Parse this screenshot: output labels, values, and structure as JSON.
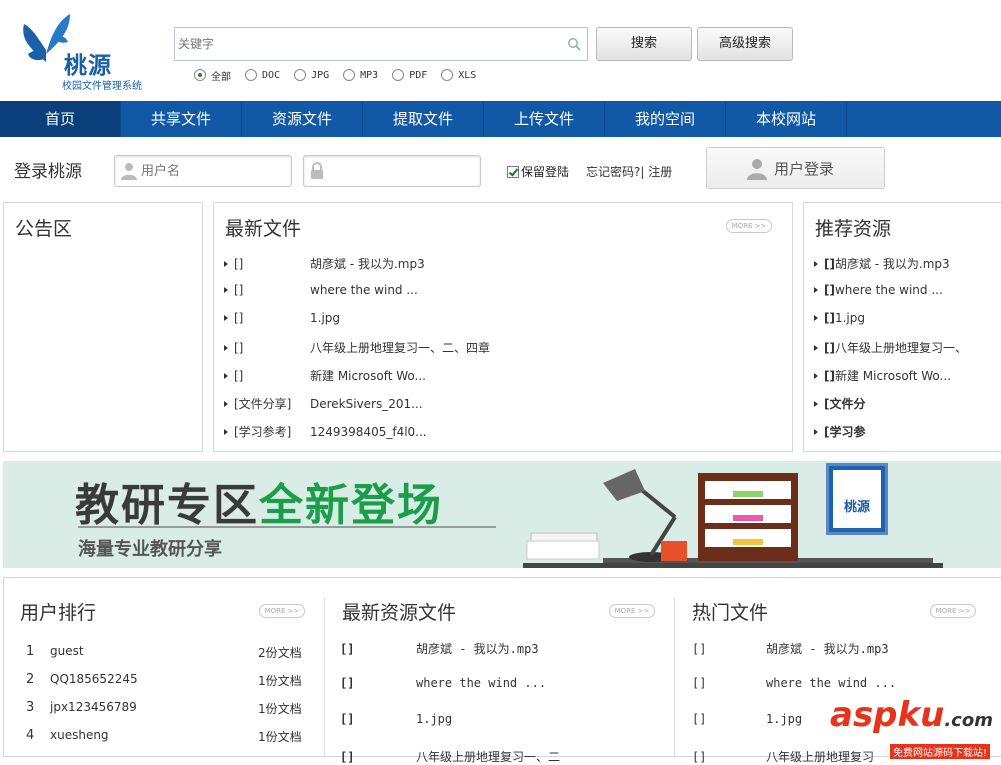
{
  "logo": {
    "name": "桃源",
    "subtitle": "校园文件管理系统"
  },
  "search": {
    "placeholder": "关键字",
    "search_label": "搜索",
    "advanced_label": "高级搜索"
  },
  "file_types": [
    {
      "label": "全部",
      "selected": true
    },
    {
      "label": "DOC",
      "selected": false
    },
    {
      "label": "JPG",
      "selected": false
    },
    {
      "label": "MP3",
      "selected": false
    },
    {
      "label": "PDF",
      "selected": false
    },
    {
      "label": "XLS",
      "selected": false
    }
  ],
  "nav": [
    "首页",
    "共享文件",
    "资源文件",
    "提取文件",
    "上传文件",
    "我的空间",
    "本校网站"
  ],
  "login": {
    "label": "登录桃源",
    "username_placeholder": "用户名",
    "remember_label": "保留登陆",
    "forgot_label": "忘记密码?| 注册",
    "button_label": "用户登录"
  },
  "notice": {
    "title": "公告区"
  },
  "latest_files": {
    "title": "最新文件",
    "more": "MORE >>",
    "items": [
      {
        "cat": "[]",
        "name": "胡彦斌 - 我以为.mp3"
      },
      {
        "cat": "[]",
        "name": "where the wind ..."
      },
      {
        "cat": "[]",
        "name": "1.jpg"
      },
      {
        "cat": "[]",
        "name": "八年级上册地理复习一、二、四章"
      },
      {
        "cat": "[]",
        "name": "新建 Microsoft Wo..."
      },
      {
        "cat": "[文件分享]",
        "name": "DerekSivers_201..."
      },
      {
        "cat": "[学习参考]",
        "name": "1249398405_f4l0..."
      }
    ]
  },
  "recommended": {
    "title": "推荐资源",
    "items": [
      {
        "cat": "[]",
        "name": "胡彦斌 - 我以为.mp3"
      },
      {
        "cat": "[]",
        "name": "where the wind ..."
      },
      {
        "cat": "[]",
        "name": "1.jpg"
      },
      {
        "cat": "[]",
        "name": "八年级上册地理复习一、"
      },
      {
        "cat": "[]",
        "name": "新建 Microsoft Wo..."
      },
      {
        "cat": "[文件分",
        "name": ""
      },
      {
        "cat": "[学习参",
        "name": ""
      }
    ]
  },
  "banner": {
    "title_dark": "教研专区",
    "title_green": "全新登场",
    "subtitle": "海量专业教研分享",
    "badge": "桃源"
  },
  "user_rank": {
    "title": "用户排行",
    "more": "MORE >>",
    "items": [
      {
        "rank": "1",
        "name": "guest",
        "count": "2份文档"
      },
      {
        "rank": "2",
        "name": "QQ185652245",
        "count": "1份文档"
      },
      {
        "rank": "3",
        "name": "jpx123456789",
        "count": "1份文档"
      },
      {
        "rank": "4",
        "name": "xuesheng",
        "count": "1份文档"
      }
    ]
  },
  "latest_resources": {
    "title": "最新资源文件",
    "more": "MORE >>",
    "items": [
      {
        "cat": "[]",
        "name": "胡彦斌 - 我以为.mp3"
      },
      {
        "cat": "[]",
        "name": "where the wind ..."
      },
      {
        "cat": "[]",
        "name": "1.jpg"
      },
      {
        "cat": "[]",
        "name": "八年级上册地理复习一、二"
      }
    ]
  },
  "hot_files": {
    "title": "热门文件",
    "more": "MORE >>",
    "items": [
      {
        "cat": "[]",
        "name": "胡彦斌 - 我以为.mp3"
      },
      {
        "cat": "[]",
        "name": "where the wind ..."
      },
      {
        "cat": "[]",
        "name": "1.jpg"
      },
      {
        "cat": "[]",
        "name": "八年级上册地理复习"
      }
    ]
  },
  "watermark": {
    "text": "aspku",
    "suffix": ".com",
    "sub": "免费网站源码下载站!"
  },
  "colors": {
    "nav_bg": "#1159a6",
    "brand_blue": "#1a5fa8",
    "accent_green": "#1a9e4a",
    "watermark_red": "#e8331c"
  }
}
